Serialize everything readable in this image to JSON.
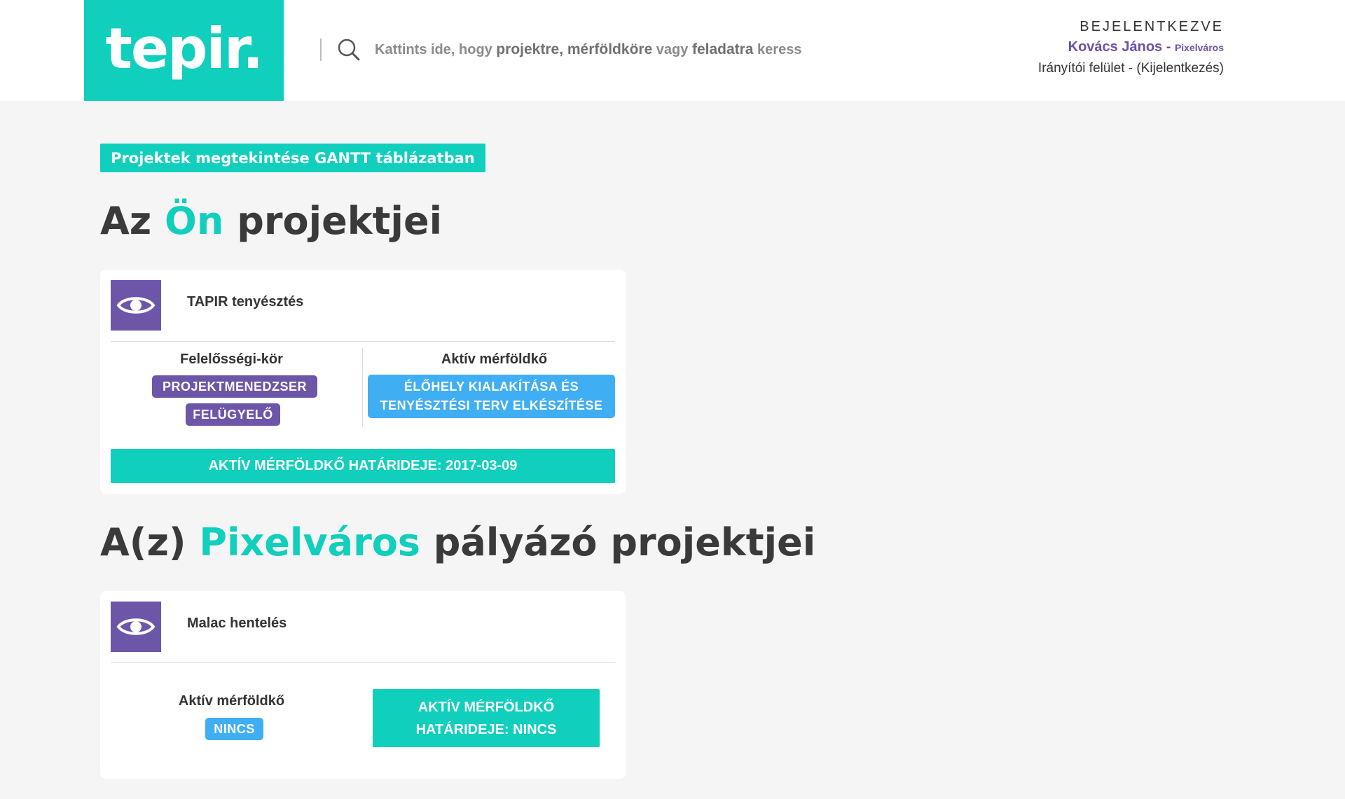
{
  "header": {
    "logo": "tepir.",
    "search": {
      "parts": [
        {
          "text": "Kattints ide, hogy ",
          "em": false
        },
        {
          "text": "projektre, mérföldköre",
          "em": true
        },
        {
          "text": " vagy ",
          "em": false
        },
        {
          "text": "feladatra",
          "em": true
        },
        {
          "text": " keress",
          "em": false
        }
      ]
    },
    "user": {
      "status": "BEJELENTKEZVE",
      "name": "Kovács János",
      "separator": " - ",
      "org": "Pixelváros",
      "dashboard_link": "Irányítói felület",
      "link_separator": " - ",
      "logout_link": "(Kijelentkezés)"
    }
  },
  "main": {
    "gantt_button": "Projektek megtekintése GANTT táblázatban",
    "own_section": {
      "title_prefix": "Az ",
      "title_accent": "Ön",
      "title_suffix": " projektjei"
    },
    "applicant_section": {
      "title_prefix": "A(z) ",
      "title_accent": "Pixelváros",
      "title_suffix": " pályázó projektjei"
    },
    "projects": [
      {
        "name": "TAPIR tenyésztés",
        "roles_title": "Felelősségi-kör",
        "roles": [
          "PROJEKTMENEDZSER",
          "FELÜGYELŐ"
        ],
        "milestone_title": "Aktív mérföldkő",
        "milestone_lines": [
          "ÉLŐHELY KIALAKÍTÁSA ÉS",
          "TENYÉSZTÉSI TERV ELKÉSZÍTÉSE"
        ],
        "deadline": "AKTÍV MÉRFÖLDKŐ HATÁRIDEJE: 2017-03-09"
      },
      {
        "name": "Malac hentelés",
        "milestone_title": "Aktív mérföldkő",
        "milestone": "NINCS",
        "deadline_lines": [
          "AKTÍV MÉRFÖLDKŐ",
          "HATÁRIDEJE: NINCS"
        ]
      }
    ]
  },
  "colors": {
    "brand_teal": "#10cfbd",
    "brand_purple": "#6d55a8",
    "milestone_blue": "#40aef3",
    "background": "#f5f5f5"
  },
  "icons": {
    "search": "search-icon",
    "view": "eye-icon"
  }
}
